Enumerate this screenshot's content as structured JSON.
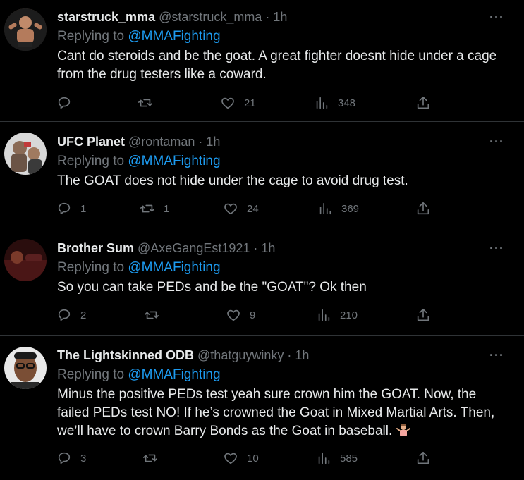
{
  "tweets": [
    {
      "name": "starstruck_mma",
      "handle_time": "@starstruck_mma · 1h",
      "replying_prefix": "Replying to ",
      "replying_to": "@MMAFighting",
      "text_lines": [
        "Cant do steroids and be the goat. A great fighter doesnt hide under a cage",
        "from the drug testers like a coward."
      ],
      "replies": "",
      "retweets": "",
      "likes": "21",
      "views": "348",
      "more": "···"
    },
    {
      "name": "UFC Planet",
      "handle_time": "@rontaman · 1h",
      "replying_prefix": "Replying to ",
      "replying_to": "@MMAFighting",
      "text_lines": [
        "The GOAT does not hide under the cage to avoid drug test."
      ],
      "replies": "1",
      "retweets": "1",
      "likes": "24",
      "views": "369",
      "more": "···"
    },
    {
      "name": "Brother Sum",
      "handle_time": "@AxeGangEst1921 · 1h",
      "replying_prefix": "Replying to ",
      "replying_to": "@MMAFighting",
      "text_lines": [
        "So you can take PEDs and be the \"GOAT\"? Ok then"
      ],
      "replies": "2",
      "retweets": "",
      "likes": "9",
      "views": "210",
      "more": "···"
    },
    {
      "name": "The Lightskinned ODB",
      "handle_time": "@thatguywinky · 1h",
      "replying_prefix": "Replying to ",
      "replying_to": "@MMAFighting",
      "text_lines": [
        "Minus the positive PEDs test yeah sure crown him the GOAT. Now, the",
        "failed PEDs test NO! If he’s crowned the Goat in Mixed Martial Arts. Then,",
        "we’ll have to crown Barry Bonds as the Goat in baseball. "
      ],
      "emoji": "person-shrugging-emoji",
      "replies": "3",
      "retweets": "",
      "likes": "10",
      "views": "585",
      "more": "···"
    }
  ],
  "colors": {
    "background": "#000000",
    "text": "#e7e9ea",
    "muted": "#71767b",
    "link": "#1d9bf0",
    "divider": "#2f3336"
  },
  "icons": [
    "reply-icon",
    "retweet-icon",
    "like-icon",
    "views-icon",
    "share-icon",
    "more-icon"
  ]
}
